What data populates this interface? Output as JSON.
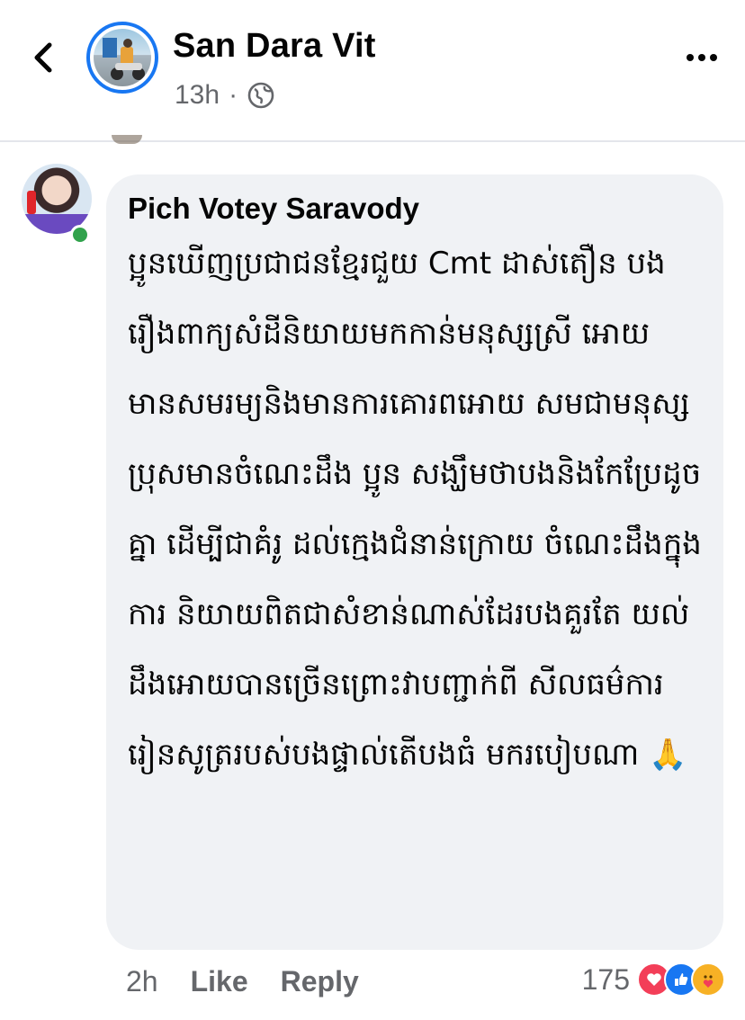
{
  "header": {
    "author_name": "San Dara Vit",
    "time": "13h",
    "separator": "·",
    "audience_icon": "globe-icon",
    "back_icon": "chevron-left-icon",
    "more_icon": "more-horizontal-icon"
  },
  "comment": {
    "commenter_name": "Pich Votey Saravody",
    "text": "ប្អូនឃើញប្រជាជនខ្មែរជួយ Cmt ដាស់តឿន បងរឿងពាក្យសំដីនិយាយមកកាន់មនុស្សស្រី អោយមានសមរម្យនិងមានការគោរពអោយ សមជាមនុស្សប្រុសមានចំណេះដឹង ប្អូន សង្ឃឹមថាបងនិងកែប្រែដូចគ្នា ដើម្បីជាគំរូ ដល់ក្មេងជំនាន់ក្រោយ ចំណេះដឹងក្នុងការ និយាយពិតជាសំខាន់ណាស់ដែរបងគួរតែ យល់ដឹងអោយបានច្រើនព្រោះវាបញ្ជាក់ពី សីលធម៌ការរៀនសូត្ររបស់បងផ្ទាល់តើបងធំ មករបៀបណា",
    "emoji": "🙏",
    "time": "2h",
    "like_label": "Like",
    "reply_label": "Reply",
    "reaction_count": "175",
    "reaction_icons": [
      "love-icon",
      "like-icon",
      "care-icon"
    ],
    "online": true
  },
  "colors": {
    "accent": "#1877f2",
    "bubble": "#f0f2f5",
    "secondary_text": "#65676b",
    "online": "#31a24c"
  }
}
